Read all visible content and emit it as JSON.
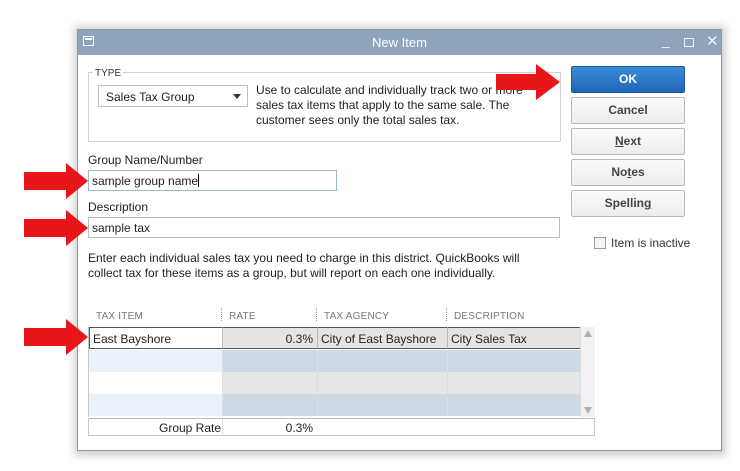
{
  "window": {
    "title": "New Item"
  },
  "type_section": {
    "legend": "TYPE",
    "selected": "Sales Tax Group",
    "description": "Use to calculate and individually track two or more sales tax items that apply to the same sale. The customer sees only the total sales tax."
  },
  "group_name": {
    "label": "Group Name/Number",
    "value": "sample group name"
  },
  "description": {
    "label": "Description",
    "value": "sample tax"
  },
  "instructions": "Enter each individual sales tax you need to charge in this district.  QuickBooks will collect tax for these items as a group, but will report on each one individually.",
  "grid": {
    "columns": [
      "TAX ITEM",
      "RATE",
      "TAX AGENCY",
      "DESCRIPTION"
    ],
    "rows": [
      {
        "tax_item": "East Bayshore",
        "rate": "0.3%",
        "tax_agency": "City of East Bayshore",
        "description": "City Sales Tax"
      },
      {
        "tax_item": "",
        "rate": "",
        "tax_agency": "",
        "description": ""
      },
      {
        "tax_item": "",
        "rate": "",
        "tax_agency": "",
        "description": ""
      },
      {
        "tax_item": "",
        "rate": "",
        "tax_agency": "",
        "description": ""
      }
    ],
    "footer": {
      "label": "Group Rate",
      "rate": "0.3%"
    }
  },
  "buttons": {
    "ok": "OK",
    "cancel": "Cancel",
    "next": "Next",
    "notes": "Notes",
    "spelling": "Spelling"
  },
  "inactive": {
    "label": "Item is inactive",
    "checked": false
  },
  "colors": {
    "titlebar": "#8fa3ba",
    "primary_button": "#2f7ccc",
    "annotation_arrow": "#e8151b"
  }
}
